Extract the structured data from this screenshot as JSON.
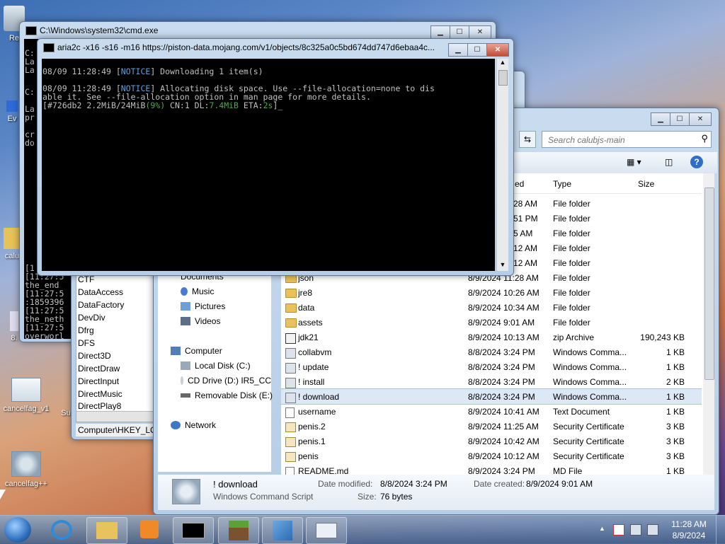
{
  "desktop": {
    "icons": [
      {
        "label": "Re"
      },
      {
        "label": "Ev"
      },
      {
        "label": "calu"
      },
      {
        "label": "8."
      },
      {
        "label": "cancelfag_v1"
      },
      {
        "label": "Su"
      },
      {
        "label": "cancelfag++"
      }
    ]
  },
  "cmd_back": {
    "title": "C:\\Windows\\system32\\cmd.exe",
    "left_lines": [
      "C:",
      "La",
      "La",
      "C:",
      "La",
      "pr",
      "",
      "cr",
      "do"
    ],
    "bottom_lines": [
      "[1",
      "[11:27:5",
      "the_end",
      "[11:27:5",
      ":1859396",
      "[11:27:5",
      "the_neth",
      "[11:27:5",
      "overworl"
    ]
  },
  "aria_window": {
    "title": "aria2c  -x16 -s16 -m16 https://piston-data.mojang.com/v1/objects/8c325a0c5bd674dd747d6ebaa4c...",
    "line1_prefix": "08/09 11:28:49 [",
    "line1_notice": "NOTICE",
    "line1_suffix": "] Downloading 1 item(s)",
    "line2_prefix": "08/09 11:28:49 [",
    "line2_notice": "NOTICE",
    "line2_suffix": "] Allocating disk space. Use --file-allocation=none to dis",
    "line3": "able it. See --file-allocation option in man page for more details.",
    "progress_open": "[",
    "progress_id": "#726db2 2.2MiB/24MiB",
    "progress_pct": "(9%)",
    "progress_cn": " CN:1 DL:",
    "progress_dl": "7.4MiB",
    "progress_eta_label": " ETA:",
    "progress_eta": "2s",
    "progress_close": "]",
    "colors": {
      "notice": "#5f9fd8",
      "pct": "#4fa84f",
      "dl": "#4fa84f",
      "eta": "#4fa84f"
    }
  },
  "regedit": {
    "keys": [
      "CTF",
      "DataAccess",
      "DataFactory",
      "DevDiv",
      "Dfrg",
      "DFS",
      "Direct3D",
      "DirectDraw",
      "DirectInput",
      "DirectMusic",
      "DirectPlay8"
    ],
    "status": "Computer\\HKEY_LO"
  },
  "explorer": {
    "search_placeholder": "Search calubjs-main",
    "columns": {
      "date_partial": "ed",
      "type": "Type",
      "size": "Size"
    },
    "nav": {
      "documents": "Documents",
      "music": "Music",
      "pictures": "Pictures",
      "videos": "Videos",
      "computer": "Computer",
      "local_disk": "Local Disk (C:)",
      "cd_drive": "CD Drive (D:) IR5_CC",
      "removable": "Removable Disk (E:)",
      "network": "Network"
    },
    "partial_rows": [
      {
        "date": "28 AM",
        "type": "File folder"
      },
      {
        "date": "51 PM",
        "type": "File folder"
      },
      {
        "date": "5 AM",
        "type": "File folder"
      },
      {
        "date": "12 AM",
        "type": "File folder"
      },
      {
        "date": "12 AM",
        "type": "File folder"
      }
    ],
    "rows": [
      {
        "name": "json",
        "date": "8/9/2024 11:28 AM",
        "type": "File folder",
        "size": "",
        "icon": "folder"
      },
      {
        "name": "jre8",
        "date": "8/9/2024 10:26 AM",
        "type": "File folder",
        "size": "",
        "icon": "folder"
      },
      {
        "name": "data",
        "date": "8/9/2024 10:34 AM",
        "type": "File folder",
        "size": "",
        "icon": "folder"
      },
      {
        "name": "assets",
        "date": "8/9/2024 9:01 AM",
        "type": "File folder",
        "size": "",
        "icon": "folder"
      },
      {
        "name": "jdk21",
        "date": "8/9/2024 10:13 AM",
        "type": "zip Archive",
        "size": "190,243 KB",
        "icon": "zip"
      },
      {
        "name": "collabvm",
        "date": "8/8/2024 3:24 PM",
        "type": "Windows Comma...",
        "size": "1 KB",
        "icon": "script"
      },
      {
        "name": "! update",
        "date": "8/8/2024 3:24 PM",
        "type": "Windows Comma...",
        "size": "1 KB",
        "icon": "script"
      },
      {
        "name": "! install",
        "date": "8/8/2024 3:24 PM",
        "type": "Windows Comma...",
        "size": "2 KB",
        "icon": "script"
      },
      {
        "name": "! download",
        "date": "8/8/2024 3:24 PM",
        "type": "Windows Comma...",
        "size": "1 KB",
        "icon": "script",
        "selected": true
      },
      {
        "name": "username",
        "date": "8/9/2024 10:41 AM",
        "type": "Text Document",
        "size": "1 KB",
        "icon": "doc"
      },
      {
        "name": "penis.2",
        "date": "8/9/2024 11:25 AM",
        "type": "Security Certificate",
        "size": "3 KB",
        "icon": "cert"
      },
      {
        "name": "penis.1",
        "date": "8/9/2024 10:42 AM",
        "type": "Security Certificate",
        "size": "3 KB",
        "icon": "cert"
      },
      {
        "name": "penis",
        "date": "8/9/2024 10:12 AM",
        "type": "Security Certificate",
        "size": "3 KB",
        "icon": "cert"
      },
      {
        "name": "README.md",
        "date": "8/9/2024 3:24 PM",
        "type": "MD File",
        "size": "1 KB",
        "icon": "doc"
      }
    ],
    "details": {
      "name": "! download",
      "kind": "Windows Command Script",
      "date_modified_label": "Date modified:",
      "date_modified": "8/8/2024 3:24 PM",
      "date_created_label": "Date created:",
      "date_created": "8/9/2024 9:01 AM",
      "size_label": "Size:",
      "size": "76 bytes"
    }
  },
  "taskbar": {
    "clock_time": "11:28 AM",
    "clock_date": "8/9/2024"
  }
}
